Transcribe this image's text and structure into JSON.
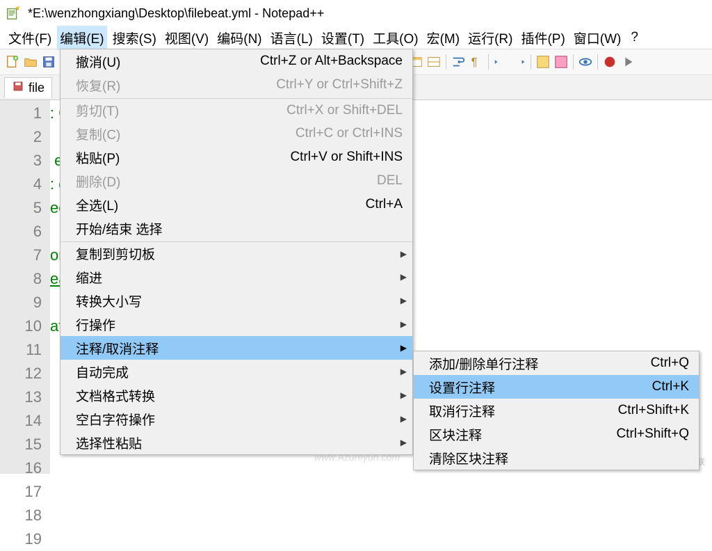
{
  "window": {
    "title": "*E:\\wenzhongxiang\\Desktop\\filebeat.yml - Notepad++"
  },
  "menubar": {
    "items": [
      "文件(F)",
      "编辑(E)",
      "搜索(S)",
      "视图(V)",
      "编码(N)",
      "语言(L)",
      "设置(T)",
      "工具(O)",
      "宏(M)",
      "运行(R)",
      "插件(P)",
      "窗口(W)",
      "?"
    ],
    "active_index": 1
  },
  "tab": {
    "label": "file"
  },
  "gutter": {
    "start": 1,
    "end": 19
  },
  "code_lines": [
    ": Configuration ##############",
    "",
    " example documenting all non-d",
    ": configuration example, that ",
    "ee filebeat.yml in the same di",
    "",
    "on reference here:",
    "eats/filebeat/index.html",
    "",
    "at prospectors ==============="
  ],
  "code_link_line_index": 7,
  "code_visible_left_col": 48,
  "edit_menu": {
    "items": [
      {
        "label": "撤消(U)",
        "shortcut": "Ctrl+Z or Alt+Backspace",
        "disabled": false
      },
      {
        "label": "恢复(R)",
        "shortcut": "Ctrl+Y or Ctrl+Shift+Z",
        "disabled": true
      },
      {
        "label": "剪切(T)",
        "shortcut": "Ctrl+X or Shift+DEL",
        "disabled": true,
        "sep": true
      },
      {
        "label": "复制(C)",
        "shortcut": "Ctrl+C or Ctrl+INS",
        "disabled": true
      },
      {
        "label": "粘贴(P)",
        "shortcut": "Ctrl+V or Shift+INS",
        "disabled": false
      },
      {
        "label": "删除(D)",
        "shortcut": "DEL",
        "disabled": true
      },
      {
        "label": "全选(L)",
        "shortcut": "Ctrl+A",
        "disabled": false
      },
      {
        "label": "开始/结束 选择",
        "shortcut": "",
        "disabled": false
      },
      {
        "label": "复制到剪切板",
        "shortcut": "",
        "disabled": false,
        "submenu": true,
        "sep": true
      },
      {
        "label": "缩进",
        "shortcut": "",
        "disabled": false,
        "submenu": true
      },
      {
        "label": "转换大小写",
        "shortcut": "",
        "disabled": false,
        "submenu": true
      },
      {
        "label": "行操作",
        "shortcut": "",
        "disabled": false,
        "submenu": true
      },
      {
        "label": "注释/取消注释",
        "shortcut": "",
        "disabled": false,
        "submenu": true,
        "highlight": true
      },
      {
        "label": "自动完成",
        "shortcut": "",
        "disabled": false,
        "submenu": true
      },
      {
        "label": "文档格式转换",
        "shortcut": "",
        "disabled": false,
        "submenu": true
      },
      {
        "label": "空白字符操作",
        "shortcut": "",
        "disabled": false,
        "submenu": true
      },
      {
        "label": "选择性粘贴",
        "shortcut": "",
        "disabled": false,
        "submenu": true
      }
    ]
  },
  "comment_submenu": {
    "items": [
      {
        "label": "添加/删除单行注释",
        "shortcut": "Ctrl+Q"
      },
      {
        "label": "设置行注释",
        "shortcut": "Ctrl+K",
        "highlight": true
      },
      {
        "label": "取消行注释",
        "shortcut": "Ctrl+Shift+K"
      },
      {
        "label": "区块注释",
        "shortcut": "Ctrl+Shift+Q"
      },
      {
        "label": "清除区块注释",
        "shortcut": ""
      }
    ]
  },
  "watermarks": {
    "corner": "创新互联",
    "center": "www.Azureyun.com"
  }
}
